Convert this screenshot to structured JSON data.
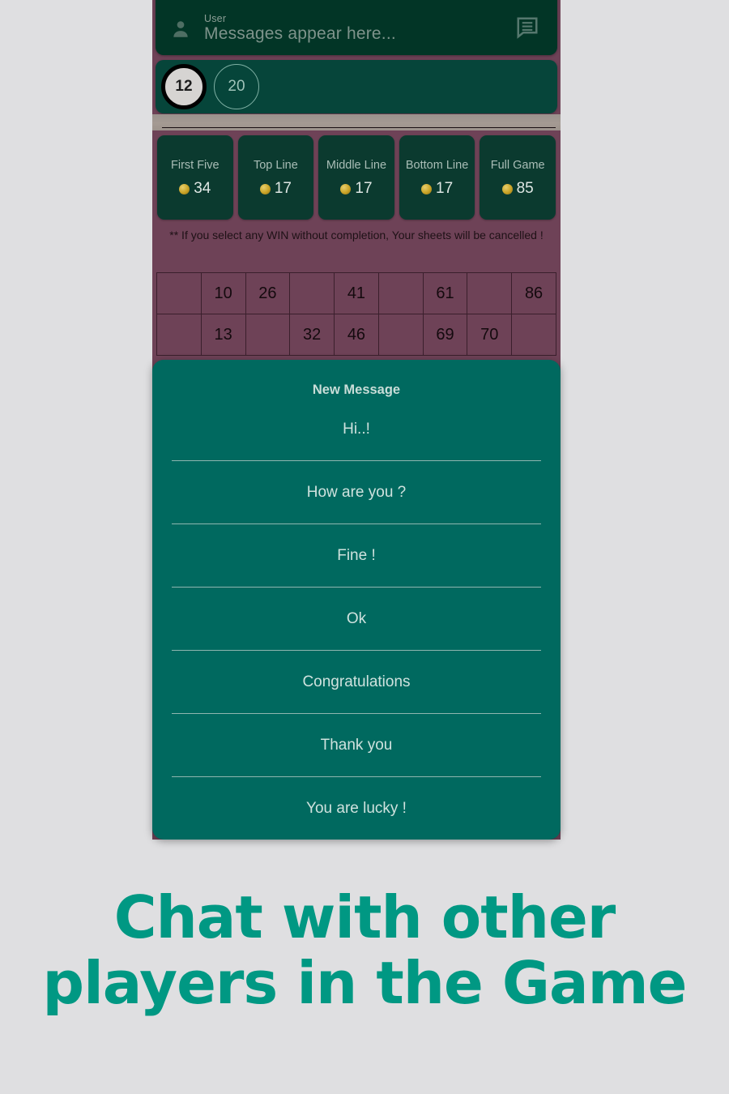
{
  "screen": {
    "background_color": "#dfdfe1",
    "board_color": "#6e4257",
    "dark_green": "#023526",
    "dialog_color": "#00695f",
    "accent_color": "#009883"
  },
  "message_bar": {
    "user_label": "User",
    "placeholder": "Messages appear here...",
    "user_icon": "person-icon",
    "chat_icon": "chat-bubble-icon"
  },
  "numbers_strip": {
    "current_number": "12",
    "previous_number": "20"
  },
  "prizes": [
    {
      "name": "First Five",
      "amount": "34",
      "coin_icon": "coin-icon"
    },
    {
      "name": "Top Line",
      "amount": "17",
      "coin_icon": "coin-icon"
    },
    {
      "name": "Middle Line",
      "amount": "17",
      "coin_icon": "coin-icon"
    },
    {
      "name": "Bottom Line",
      "amount": "17",
      "coin_icon": "coin-icon"
    },
    {
      "name": "Full Game",
      "amount": "85",
      "coin_icon": "coin-icon"
    }
  ],
  "warning": "** If you select any WIN without completion, Your sheets will be cancelled !",
  "ticket": {
    "columns": 9,
    "rows": [
      [
        "",
        "10",
        "26",
        "",
        "41",
        "",
        "61",
        "",
        "86"
      ],
      [
        "",
        "13",
        "",
        "32",
        "46",
        "",
        "69",
        "70",
        ""
      ]
    ]
  },
  "dialog": {
    "title": "New Message",
    "options": [
      "Hi..!",
      "How are you ?",
      "Fine !",
      "Ok",
      "Congratulations",
      "Thank you",
      "You are lucky !"
    ]
  },
  "caption": {
    "line1": "Chat with other",
    "line2": "players in the Game"
  }
}
